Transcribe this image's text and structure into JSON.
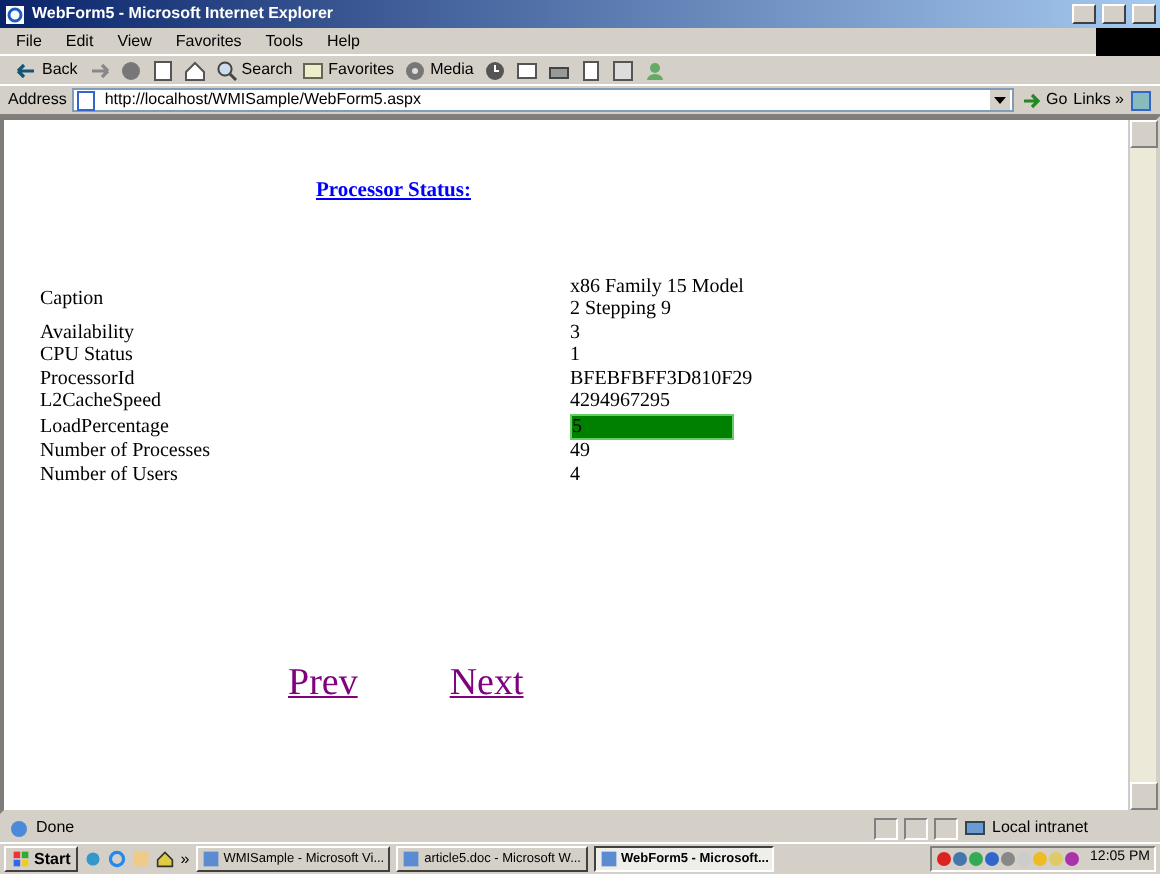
{
  "window": {
    "title": "WebForm5 - Microsoft Internet Explorer"
  },
  "menu": [
    "File",
    "Edit",
    "View",
    "Favorites",
    "Tools",
    "Help"
  ],
  "toolbar": [
    {
      "kind": "back",
      "label": "Back"
    },
    {
      "kind": "forward"
    },
    {
      "kind": "stop"
    },
    {
      "kind": "refresh"
    },
    {
      "kind": "home"
    },
    {
      "kind": "search",
      "label": "Search"
    },
    {
      "kind": "favorites",
      "label": "Favorites"
    },
    {
      "kind": "media",
      "label": "Media"
    },
    {
      "kind": "history"
    },
    {
      "kind": "mail"
    },
    {
      "kind": "print"
    },
    {
      "kind": "edit"
    },
    {
      "kind": "discuss"
    },
    {
      "kind": "messenger"
    }
  ],
  "address_bar": {
    "label": "Address",
    "url": "http://localhost/WMISample/WebForm5.aspx",
    "go": "Go",
    "links": "Links",
    "links_more": "»"
  },
  "page": {
    "heading": "Processor Status:",
    "rows": [
      {
        "name": "Caption",
        "value": "x86 Family 15 Model 2 Stepping 9",
        "highlighted": false
      },
      {
        "name": "Availability",
        "value": "3",
        "highlighted": false
      },
      {
        "name": "CPU Status",
        "value": "1",
        "highlighted": false
      },
      {
        "name": "ProcessorId",
        "value": "BFEBFBFF3D810F29",
        "highlighted": false
      },
      {
        "name": "L2CacheSpeed",
        "value": "4294967295",
        "highlighted": false
      },
      {
        "name": "LoadPercentage",
        "value": "5",
        "highlighted": true
      },
      {
        "name": "Number of Processes",
        "value": "49",
        "highlighted": false
      },
      {
        "name": "Number of Users",
        "value": "4",
        "highlighted": false
      }
    ],
    "links": [
      "Prev",
      "Next"
    ]
  },
  "status_bar": {
    "text": "Done",
    "zone": "Local intranet"
  },
  "taskbar": {
    "start": "Start",
    "more": "»",
    "clock": "12:05 PM",
    "tasks": [
      {
        "label": "WMISample - Microsoft Vi...",
        "selected": false
      },
      {
        "label": "article5.doc - Microsoft W...",
        "selected": false
      },
      {
        "label": "WebForm5 - Microsoft...",
        "selected": true
      }
    ]
  }
}
